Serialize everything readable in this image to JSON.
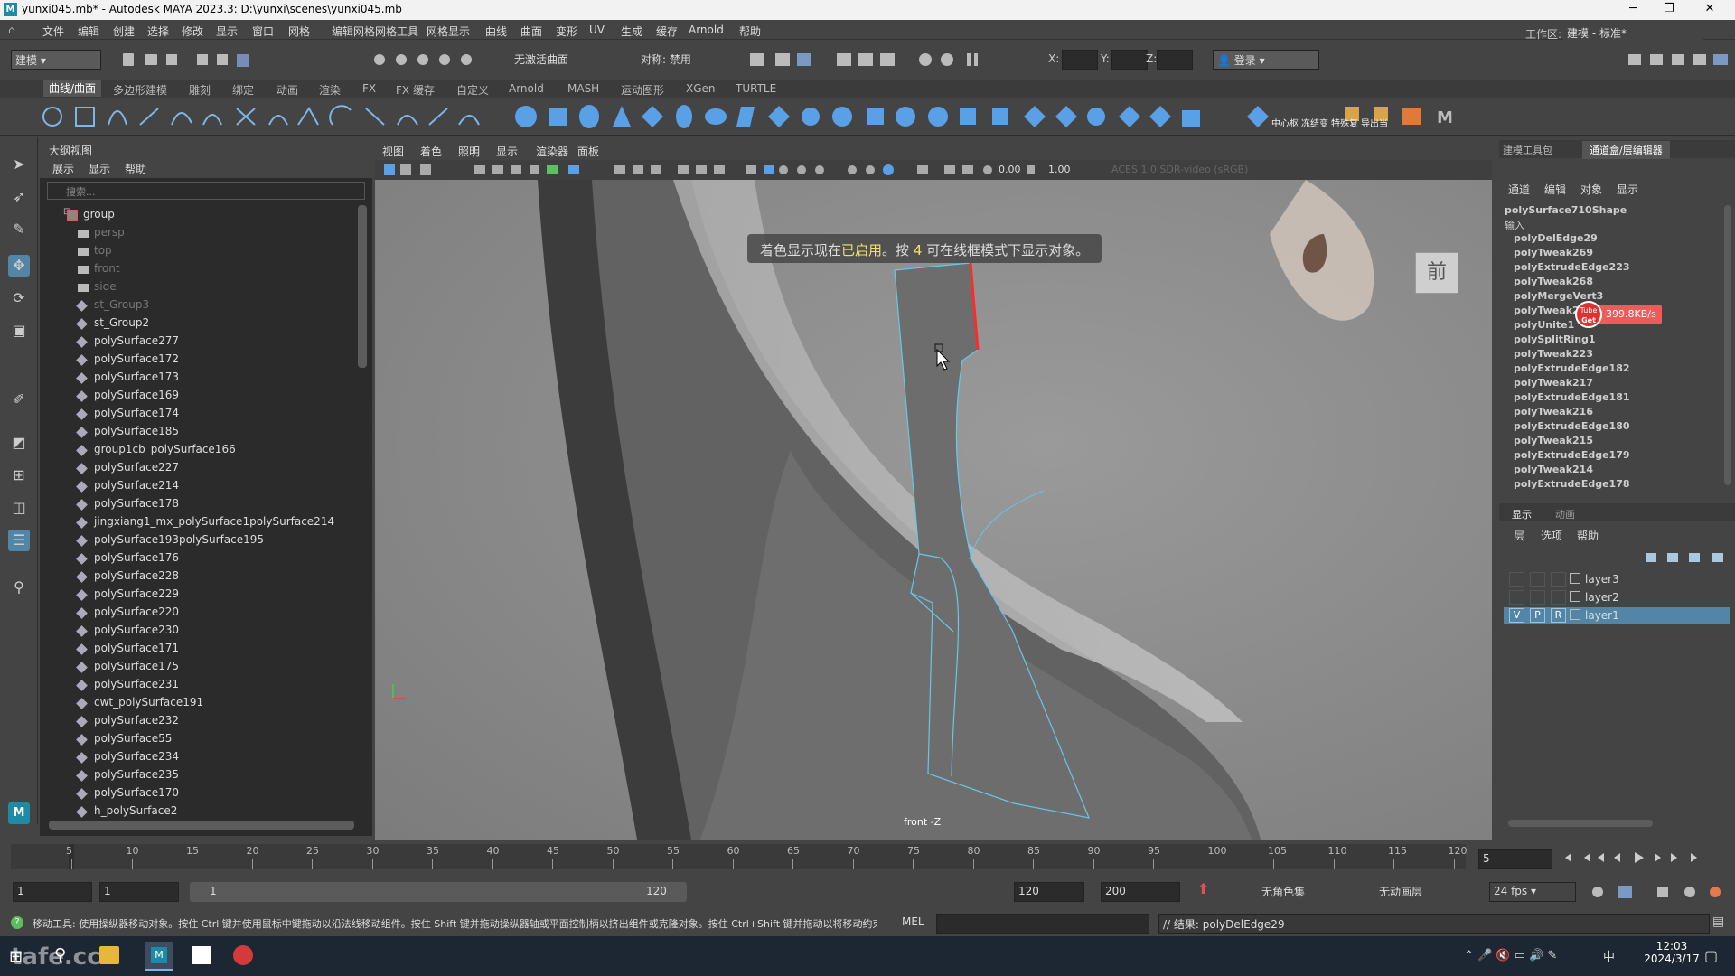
{
  "window": {
    "title": "yunxi045.mb* - Autodesk MAYA 2023.3: D:\\yunxi\\scenes\\yunxi045.mb"
  },
  "menu": [
    "文件",
    "编辑",
    "创建",
    "选择",
    "修改",
    "显示",
    "窗口",
    "网格",
    "编辑网格",
    "网格工具",
    "网格显示",
    "曲线",
    "曲面",
    "变形",
    "UV",
    "生成",
    "缓存",
    "Arnold",
    "帮助"
  ],
  "statusline": {
    "mode": "建模",
    "live_surface": "无激活曲面",
    "symmetry": "对称: 禁用",
    "x_label": "X:",
    "y_label": "Y:",
    "z_label": "Z:",
    "login": "登录",
    "workspace_label": "工作区:",
    "workspace_value": "建模 - 标准*"
  },
  "shelf_tabs": [
    "曲线/曲面",
    "多边形建模",
    "雕刻",
    "绑定",
    "动画",
    "渲染",
    "FX",
    "FX 缓存",
    "自定义",
    "Arnold",
    "MASH",
    "运动图形",
    "XGen",
    "TURTLE"
  ],
  "shelf_text_buttons": [
    "中心枢",
    "冻结变",
    "特殊复",
    "导出当"
  ],
  "outliner": {
    "title": "大纲视图",
    "menus": [
      "展示",
      "显示",
      "帮助"
    ],
    "search_placeholder": "搜索...",
    "items": [
      {
        "name": "group",
        "type": "group",
        "dim": false,
        "indent": 0
      },
      {
        "name": "persp",
        "type": "camera",
        "dim": true,
        "indent": 1
      },
      {
        "name": "top",
        "type": "camera",
        "dim": true,
        "indent": 1
      },
      {
        "name": "front",
        "type": "camera",
        "dim": true,
        "indent": 1
      },
      {
        "name": "side",
        "type": "camera",
        "dim": true,
        "indent": 1
      },
      {
        "name": "st_Group3",
        "type": "mesh",
        "dim": true,
        "indent": 1
      },
      {
        "name": "st_Group2",
        "type": "mesh",
        "dim": false,
        "indent": 1
      },
      {
        "name": "polySurface277",
        "type": "mesh",
        "dim": false,
        "indent": 1
      },
      {
        "name": "polySurface172",
        "type": "mesh",
        "dim": false,
        "indent": 1
      },
      {
        "name": "polySurface173",
        "type": "mesh",
        "dim": false,
        "indent": 1
      },
      {
        "name": "polySurface169",
        "type": "mesh",
        "dim": false,
        "indent": 1
      },
      {
        "name": "polySurface174",
        "type": "mesh",
        "dim": false,
        "indent": 1
      },
      {
        "name": "polySurface185",
        "type": "mesh",
        "dim": false,
        "indent": 1
      },
      {
        "name": "group1cb_polySurface166",
        "type": "mesh",
        "dim": false,
        "indent": 1
      },
      {
        "name": "polySurface227",
        "type": "mesh",
        "dim": false,
        "indent": 1
      },
      {
        "name": "polySurface214",
        "type": "mesh",
        "dim": false,
        "indent": 1
      },
      {
        "name": "polySurface178",
        "type": "mesh",
        "dim": false,
        "indent": 1
      },
      {
        "name": "jingxiang1_mx_polySurface1polySurface214",
        "type": "mesh",
        "dim": false,
        "indent": 1
      },
      {
        "name": "polySurface193polySurface195",
        "type": "mesh",
        "dim": false,
        "indent": 1
      },
      {
        "name": "polySurface176",
        "type": "mesh",
        "dim": false,
        "indent": 1
      },
      {
        "name": "polySurface228",
        "type": "mesh",
        "dim": false,
        "indent": 1
      },
      {
        "name": "polySurface229",
        "type": "mesh",
        "dim": false,
        "indent": 1
      },
      {
        "name": "polySurface220",
        "type": "mesh",
        "dim": false,
        "indent": 1
      },
      {
        "name": "polySurface230",
        "type": "mesh",
        "dim": false,
        "indent": 1
      },
      {
        "name": "polySurface171",
        "type": "mesh",
        "dim": false,
        "indent": 1
      },
      {
        "name": "polySurface175",
        "type": "mesh",
        "dim": false,
        "indent": 1
      },
      {
        "name": "polySurface231",
        "type": "mesh",
        "dim": false,
        "indent": 1
      },
      {
        "name": "cwt_polySurface191",
        "type": "mesh",
        "dim": false,
        "indent": 1
      },
      {
        "name": "polySurface232",
        "type": "mesh",
        "dim": false,
        "indent": 1
      },
      {
        "name": "polySurface55",
        "type": "mesh",
        "dim": false,
        "indent": 1
      },
      {
        "name": "polySurface234",
        "type": "mesh",
        "dim": false,
        "indent": 1
      },
      {
        "name": "polySurface235",
        "type": "mesh",
        "dim": false,
        "indent": 1
      },
      {
        "name": "polySurface170",
        "type": "mesh",
        "dim": false,
        "indent": 1
      },
      {
        "name": "h_polySurface2",
        "type": "mesh",
        "dim": false,
        "indent": 1
      }
    ]
  },
  "viewport": {
    "menus": [
      "视图",
      "着色",
      "照明",
      "显示",
      "渲染器",
      "面板"
    ],
    "exposure": "0.00",
    "gamma": "1.00",
    "colorspace": "ACES 1.0 SDR-video (sRGB)",
    "hud_prefix": "着色显示现在",
    "hud_enabled": "已启用",
    "hud_mid": "。按",
    "hud_key": "4",
    "hud_suffix": "可在线框模式下显示对象。",
    "viewcube_label": "前",
    "camera_label": "front -Z"
  },
  "channelbox": {
    "tabs": [
      "建模工具包",
      "通道盒/层编辑器"
    ],
    "menus": [
      "通道",
      "编辑",
      "对象",
      "显示"
    ],
    "shape": "polySurface710Shape",
    "inputs_label": "输入",
    "history": [
      "polyDelEdge29",
      "polyTweak269",
      "polyExtrudeEdge223",
      "polyTweak268",
      "polyMergeVert3",
      "polyTweak267",
      "polyUnite1",
      "polySplitRing1",
      "polyTweak223",
      "polyExtrudeEdge182",
      "polyTweak217",
      "polyExtrudeEdge181",
      "polyTweak216",
      "polyExtrudeEdge180",
      "polyTweak215",
      "polyExtrudeEdge179",
      "polyTweak214",
      "polyExtrudeEdge178"
    ],
    "badge_speed": "399.8KB/s",
    "badge_logo_top": "Tube",
    "badge_logo_bottom": "Get"
  },
  "layers": {
    "tabs": [
      "显示",
      "动画"
    ],
    "menus": [
      "层",
      "选项",
      "帮助"
    ],
    "items": [
      {
        "name": "layer3",
        "v": "",
        "p": "",
        "r": "",
        "selected": false
      },
      {
        "name": "layer2",
        "v": "",
        "p": "",
        "r": "",
        "selected": false
      },
      {
        "name": "layer1",
        "v": "V",
        "p": "P",
        "r": "R",
        "selected": true
      }
    ]
  },
  "timeline": {
    "ticks": [
      "5",
      "10",
      "15",
      "20",
      "25",
      "30",
      "35",
      "40",
      "45",
      "50",
      "55",
      "60",
      "65",
      "70",
      "75",
      "80",
      "85",
      "90",
      "95",
      "100",
      "105",
      "110",
      "115",
      "120"
    ],
    "current_frame": "5",
    "range_start": "1",
    "anim_start": "1",
    "range_inner_start": "1",
    "range_inner_end": "120",
    "range_end": "120",
    "anim_end": "200",
    "char_set": "无角色集",
    "anim_layer": "无动画层",
    "fps": "24 fps"
  },
  "commandline": {
    "help_text": "移动工具: 使用操纵器移动对象。按住 Ctrl 键并使用鼠标中键拖动以沿法线移动组件。按住 Shift 键并拖动操纵器轴或平面控制柄以挤出组件或克隆对象。按住 Ctrl+Shift 键并拖动以将移动约束",
    "lang": "MEL",
    "result": "// 结果: polyDelEdge29"
  },
  "taskbar": {
    "time": "12:03",
    "date": "2024/3/17",
    "ime": "中",
    "watermark": "tafe.cc"
  }
}
